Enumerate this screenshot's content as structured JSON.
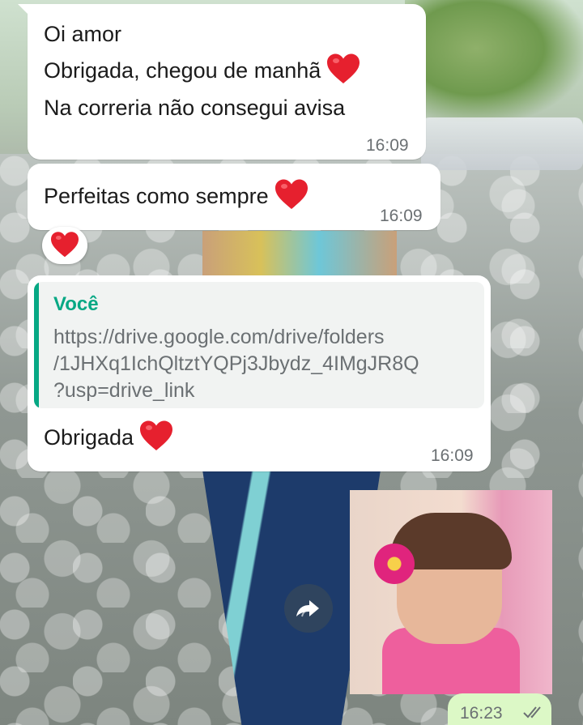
{
  "messages": {
    "m1": {
      "lines": [
        "Oi amor",
        "Obrigada, chegou de manhã",
        "Na correria não consegui avisa"
      ],
      "time": "16:09"
    },
    "m2": {
      "text": "Perfeitas como sempre",
      "time": "16:09"
    },
    "reaction": {
      "emoji": "heart-icon"
    },
    "m3": {
      "quote_author": "Você",
      "quote_lines": [
        "https://drive.google.com/drive/folders",
        "/1JHXq1IchQltztYQPj3Jbydz_4IMgJR8Q",
        "?usp=drive_link"
      ],
      "text": "Obrigada",
      "time": "16:09"
    },
    "sticker": {
      "time": "16:23",
      "status": "read"
    }
  },
  "colors": {
    "incoming_bubble": "#ffffff",
    "outgoing_bubble": "#dcf8c6",
    "quote_accent": "#06a884",
    "heart": "#e6202e"
  }
}
